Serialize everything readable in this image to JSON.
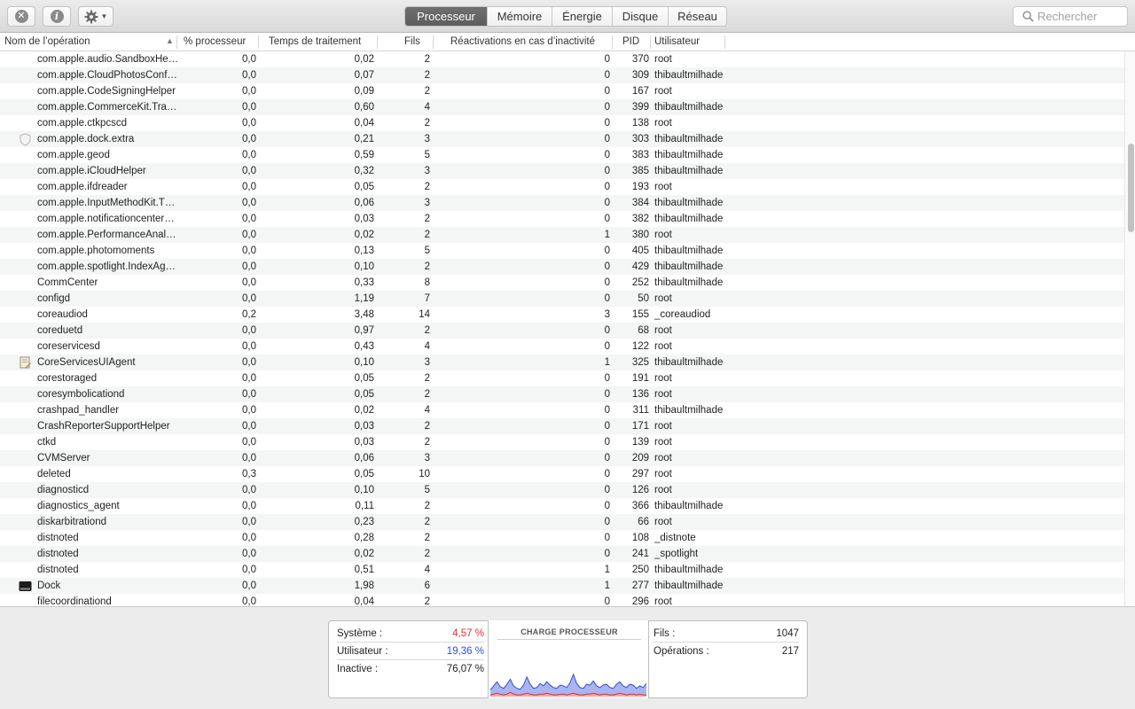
{
  "toolbar": {
    "close_icon": "close-circle-icon",
    "info_icon": "info-circle-icon",
    "gear_icon": "gear-icon",
    "tabs": [
      {
        "label": "Processeur",
        "active": true
      },
      {
        "label": "Mémoire",
        "active": false
      },
      {
        "label": "Énergie",
        "active": false
      },
      {
        "label": "Disque",
        "active": false
      },
      {
        "label": "Réseau",
        "active": false
      }
    ],
    "search_placeholder": "Rechercher"
  },
  "columns": {
    "name": "Nom de l’opération",
    "cpu": "% processeur",
    "time": "Temps de traitement",
    "threads": "Fils",
    "wakeups": "Réactivations en cas d’inactivité",
    "pid": "PID",
    "user": "Utilisateur"
  },
  "rows": [
    {
      "name": "com.apple.audio.SandboxHe…",
      "cpu": "0,0",
      "time": "0,02",
      "threads": "2",
      "wakeups": "0",
      "pid": "370",
      "user": "root",
      "icon": ""
    },
    {
      "name": "com.apple.CloudPhotosConf…",
      "cpu": "0,0",
      "time": "0,07",
      "threads": "2",
      "wakeups": "0",
      "pid": "309",
      "user": "thibaultmilhade",
      "icon": ""
    },
    {
      "name": "com.apple.CodeSigningHelper",
      "cpu": "0,0",
      "time": "0,09",
      "threads": "2",
      "wakeups": "0",
      "pid": "167",
      "user": "root",
      "icon": ""
    },
    {
      "name": "com.apple.CommerceKit.Tra…",
      "cpu": "0,0",
      "time": "0,60",
      "threads": "4",
      "wakeups": "0",
      "pid": "399",
      "user": "thibaultmilhade",
      "icon": ""
    },
    {
      "name": "com.apple.ctkpcscd",
      "cpu": "0,0",
      "time": "0,04",
      "threads": "2",
      "wakeups": "0",
      "pid": "138",
      "user": "root",
      "icon": ""
    },
    {
      "name": "com.apple.dock.extra",
      "cpu": "0,0",
      "time": "0,21",
      "threads": "3",
      "wakeups": "0",
      "pid": "303",
      "user": "thibaultmilhade",
      "icon": "shield-icon"
    },
    {
      "name": "com.apple.geod",
      "cpu": "0,0",
      "time": "0,59",
      "threads": "5",
      "wakeups": "0",
      "pid": "383",
      "user": "thibaultmilhade",
      "icon": ""
    },
    {
      "name": "com.apple.iCloudHelper",
      "cpu": "0,0",
      "time": "0,32",
      "threads": "3",
      "wakeups": "0",
      "pid": "385",
      "user": "thibaultmilhade",
      "icon": ""
    },
    {
      "name": "com.apple.ifdreader",
      "cpu": "0,0",
      "time": "0,05",
      "threads": "2",
      "wakeups": "0",
      "pid": "193",
      "user": "root",
      "icon": ""
    },
    {
      "name": "com.apple.InputMethodKit.T…",
      "cpu": "0,0",
      "time": "0,06",
      "threads": "3",
      "wakeups": "0",
      "pid": "384",
      "user": "thibaultmilhade",
      "icon": ""
    },
    {
      "name": "com.apple.notificationcenter…",
      "cpu": "0,0",
      "time": "0,03",
      "threads": "2",
      "wakeups": "0",
      "pid": "382",
      "user": "thibaultmilhade",
      "icon": ""
    },
    {
      "name": "com.apple.PerformanceAnal…",
      "cpu": "0,0",
      "time": "0,02",
      "threads": "2",
      "wakeups": "1",
      "pid": "380",
      "user": "root",
      "icon": ""
    },
    {
      "name": "com.apple.photomoments",
      "cpu": "0,0",
      "time": "0,13",
      "threads": "5",
      "wakeups": "0",
      "pid": "405",
      "user": "thibaultmilhade",
      "icon": ""
    },
    {
      "name": "com.apple.spotlight.IndexAg…",
      "cpu": "0,0",
      "time": "0,10",
      "threads": "2",
      "wakeups": "0",
      "pid": "429",
      "user": "thibaultmilhade",
      "icon": ""
    },
    {
      "name": "CommCenter",
      "cpu": "0,0",
      "time": "0,33",
      "threads": "8",
      "wakeups": "0",
      "pid": "252",
      "user": "thibaultmilhade",
      "icon": ""
    },
    {
      "name": "configd",
      "cpu": "0,0",
      "time": "1,19",
      "threads": "7",
      "wakeups": "0",
      "pid": "50",
      "user": "root",
      "icon": ""
    },
    {
      "name": "coreaudiod",
      "cpu": "0,2",
      "time": "3,48",
      "threads": "14",
      "wakeups": "3",
      "pid": "155",
      "user": "_coreaudiod",
      "icon": ""
    },
    {
      "name": "coreduetd",
      "cpu": "0,0",
      "time": "0,97",
      "threads": "2",
      "wakeups": "0",
      "pid": "68",
      "user": "root",
      "icon": ""
    },
    {
      "name": "coreservicesd",
      "cpu": "0,0",
      "time": "0,43",
      "threads": "4",
      "wakeups": "0",
      "pid": "122",
      "user": "root",
      "icon": ""
    },
    {
      "name": "CoreServicesUIAgent",
      "cpu": "0,0",
      "time": "0,10",
      "threads": "3",
      "wakeups": "1",
      "pid": "325",
      "user": "thibaultmilhade",
      "icon": "agent-app-icon"
    },
    {
      "name": "corestoraged",
      "cpu": "0,0",
      "time": "0,05",
      "threads": "2",
      "wakeups": "0",
      "pid": "191",
      "user": "root",
      "icon": ""
    },
    {
      "name": "coresymbolicationd",
      "cpu": "0,0",
      "time": "0,05",
      "threads": "2",
      "wakeups": "0",
      "pid": "136",
      "user": "root",
      "icon": ""
    },
    {
      "name": "crashpad_handler",
      "cpu": "0,0",
      "time": "0,02",
      "threads": "4",
      "wakeups": "0",
      "pid": "311",
      "user": "thibaultmilhade",
      "icon": ""
    },
    {
      "name": "CrashReporterSupportHelper",
      "cpu": "0,0",
      "time": "0,03",
      "threads": "2",
      "wakeups": "0",
      "pid": "171",
      "user": "root",
      "icon": ""
    },
    {
      "name": "ctkd",
      "cpu": "0,0",
      "time": "0,03",
      "threads": "2",
      "wakeups": "0",
      "pid": "139",
      "user": "root",
      "icon": ""
    },
    {
      "name": "CVMServer",
      "cpu": "0,0",
      "time": "0,06",
      "threads": "3",
      "wakeups": "0",
      "pid": "209",
      "user": "root",
      "icon": ""
    },
    {
      "name": "deleted",
      "cpu": "0,3",
      "time": "0,05",
      "threads": "10",
      "wakeups": "0",
      "pid": "297",
      "user": "root",
      "icon": ""
    },
    {
      "name": "diagnosticd",
      "cpu": "0,0",
      "time": "0,10",
      "threads": "5",
      "wakeups": "0",
      "pid": "126",
      "user": "root",
      "icon": ""
    },
    {
      "name": "diagnostics_agent",
      "cpu": "0,0",
      "time": "0,11",
      "threads": "2",
      "wakeups": "0",
      "pid": "366",
      "user": "thibaultmilhade",
      "icon": ""
    },
    {
      "name": "diskarbitrationd",
      "cpu": "0,0",
      "time": "0,23",
      "threads": "2",
      "wakeups": "0",
      "pid": "66",
      "user": "root",
      "icon": ""
    },
    {
      "name": "distnoted",
      "cpu": "0,0",
      "time": "0,28",
      "threads": "2",
      "wakeups": "0",
      "pid": "108",
      "user": "_distnote",
      "icon": ""
    },
    {
      "name": "distnoted",
      "cpu": "0,0",
      "time": "0,02",
      "threads": "2",
      "wakeups": "0",
      "pid": "241",
      "user": "_spotlight",
      "icon": ""
    },
    {
      "name": "distnoted",
      "cpu": "0,0",
      "time": "0,51",
      "threads": "4",
      "wakeups": "1",
      "pid": "250",
      "user": "thibaultmilhade",
      "icon": ""
    },
    {
      "name": "Dock",
      "cpu": "0,0",
      "time": "1,98",
      "threads": "6",
      "wakeups": "1",
      "pid": "277",
      "user": "thibaultmilhade",
      "icon": "dock-app-icon"
    },
    {
      "name": "filecoordinationd",
      "cpu": "0,0",
      "time": "0,04",
      "threads": "2",
      "wakeups": "0",
      "pid": "296",
      "user": "root",
      "icon": ""
    }
  ],
  "stats": {
    "system_label": "Système :",
    "system_value": "4,57 %",
    "user_label": "Utilisateur :",
    "user_value": "19,36 %",
    "idle_label": "Inactive :",
    "idle_value": "76,07 %",
    "chart_title": "CHARGE PROCESSEUR",
    "threads_label": "Fils :",
    "threads_value": "1047",
    "processes_label": "Opérations :",
    "processes_value": "217"
  },
  "colors": {
    "system": "#e0312b",
    "user": "#2d4fd6",
    "active_tab": "#646464"
  },
  "chart_data": {
    "type": "area",
    "title": "CHARGE PROCESSEUR",
    "series": [
      {
        "name": "Système",
        "values": [
          2,
          3,
          4,
          3,
          2,
          3,
          5,
          3,
          2,
          2,
          3,
          4,
          3,
          2,
          2,
          3,
          3,
          4,
          3,
          2,
          2,
          3,
          3,
          2,
          3,
          4,
          3,
          2,
          2,
          3,
          3,
          4,
          3,
          2,
          3,
          3,
          2,
          2,
          3,
          4,
          3,
          2,
          3,
          3,
          2,
          3,
          2,
          2
        ]
      },
      {
        "name": "Utilisateur",
        "values": [
          6,
          10,
          14,
          9,
          8,
          12,
          16,
          10,
          8,
          7,
          11,
          20,
          12,
          8,
          9,
          13,
          10,
          14,
          11,
          9,
          8,
          11,
          10,
          9,
          14,
          23,
          13,
          9,
          8,
          12,
          11,
          15,
          10,
          9,
          11,
          12,
          9,
          8,
          12,
          14,
          10,
          9,
          12,
          11,
          8,
          10,
          9,
          14
        ]
      }
    ],
    "ylim": [
      0,
      100
    ]
  }
}
